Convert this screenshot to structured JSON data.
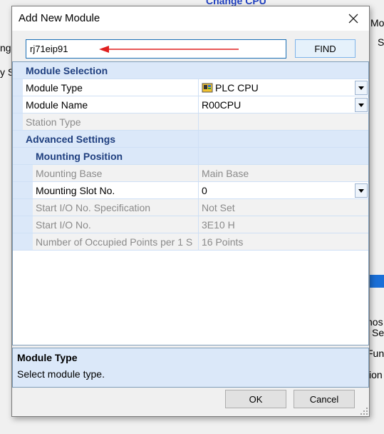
{
  "background": {
    "fragments": [
      "Change CPU",
      "Mo",
      "S",
      "ng",
      "y S",
      "hos",
      "Se",
      "Fun",
      "ion"
    ]
  },
  "dialog": {
    "title": "Add New Module",
    "search_value": "rj71eip91",
    "find_label": "FIND",
    "sections": {
      "module_selection": "Module Selection",
      "advanced_settings": "Advanced Settings",
      "mounting_position": "Mounting Position"
    },
    "rows": {
      "module_type": {
        "label": "Module Type",
        "value": "PLC CPU"
      },
      "module_name": {
        "label": "Module Name",
        "value": "R00CPU"
      },
      "station_type": {
        "label": "Station Type",
        "value": ""
      },
      "mounting_base": {
        "label": "Mounting Base",
        "value": "Main Base"
      },
      "mounting_slot": {
        "label": "Mounting Slot No.",
        "value": "0"
      },
      "start_io_spec": {
        "label": "Start I/O No. Specification",
        "value": "Not Set"
      },
      "start_io": {
        "label": "Start I/O No.",
        "value": "3E10 H"
      },
      "occupied_points": {
        "label": "Number of Occupied Points per 1 S",
        "value": "16 Points"
      }
    },
    "description": {
      "title": "Module Type",
      "text": "Select module type."
    },
    "ok_label": "OK",
    "cancel_label": "Cancel"
  },
  "colors": {
    "category_bg": "#dbe8f9",
    "category_text": "#1f3f7f",
    "arrow": "#e02020",
    "accent_border": "#1a6fb5"
  },
  "icons": [
    "plc-cpu-icon",
    "close-icon",
    "chevron-down-icon",
    "resize-grip-icon"
  ]
}
